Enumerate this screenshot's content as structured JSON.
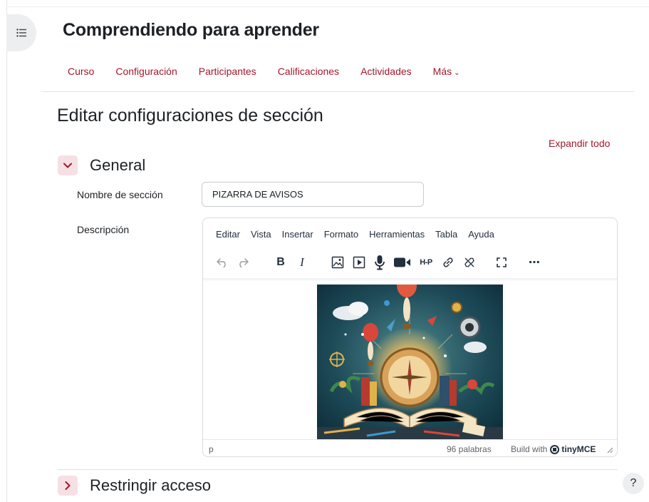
{
  "course": {
    "title": "Comprendiendo para aprender"
  },
  "nav": {
    "tabs": [
      {
        "label": "Curso"
      },
      {
        "label": "Configuración"
      },
      {
        "label": "Participantes"
      },
      {
        "label": "Calificaciones"
      },
      {
        "label": "Actividades"
      },
      {
        "label": "Más"
      }
    ]
  },
  "page": {
    "heading": "Editar configuraciones de sección",
    "expand_all": "Expandir todo"
  },
  "general": {
    "title": "General",
    "name_label": "Nombre de sección",
    "name_value": "PIZARRA DE AVISOS",
    "description_label": "Descripción"
  },
  "editor": {
    "menu": [
      "Editar",
      "Vista",
      "Insertar",
      "Formato",
      "Herramientas",
      "Tabla",
      "Ayuda"
    ],
    "toolbar_icons": [
      "undo-icon",
      "redo-icon",
      "bold-icon",
      "italic-icon",
      "image-icon",
      "media-icon",
      "microphone-icon",
      "video-camera-icon",
      "h5p-icon",
      "link-icon",
      "unlink-icon",
      "fullscreen-icon",
      "more-icon"
    ],
    "status_path": "p",
    "word_count": "96 palabras",
    "build_with": "Build with",
    "brand": "tinyMCE"
  },
  "restrict": {
    "title": "Restringir acceso"
  },
  "help": {
    "label": "?"
  },
  "colors": {
    "accent": "#a3182b",
    "accent_bg": "#f6e0e3",
    "text": "#1d2125"
  }
}
